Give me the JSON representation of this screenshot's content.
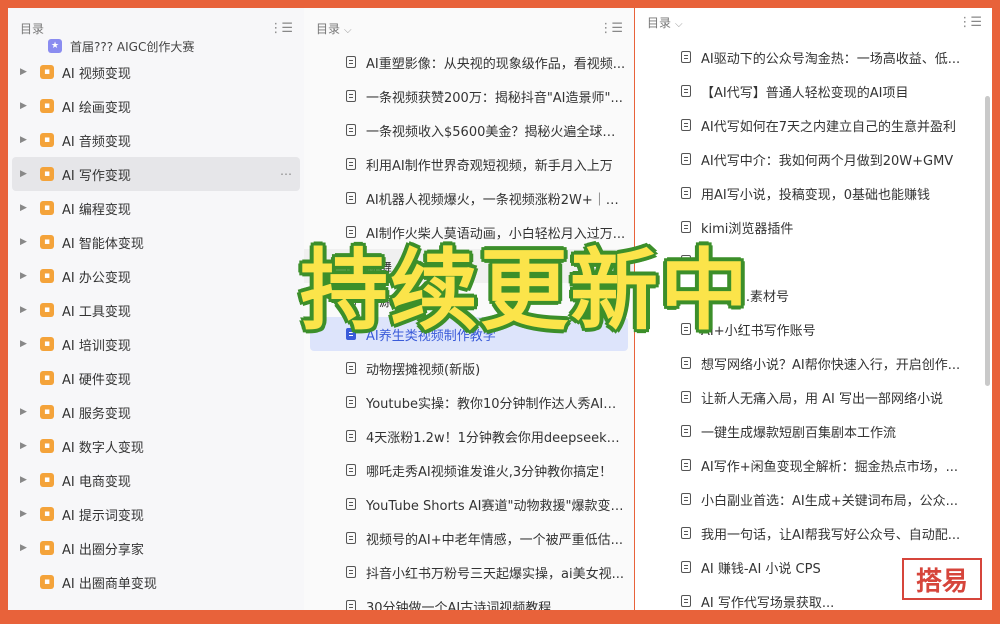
{
  "pane1": {
    "header": "目录",
    "first_item": "首届??? AIGC创作大赛",
    "items": [
      {
        "label": "AI 视频变现"
      },
      {
        "label": "AI 绘画变现"
      },
      {
        "label": "AI 音频变现"
      },
      {
        "label": "AI 写作变现"
      },
      {
        "label": "AI 编程变现"
      },
      {
        "label": "AI 智能体变现"
      },
      {
        "label": "AI 办公变现"
      },
      {
        "label": "AI 工具变现"
      },
      {
        "label": "AI 培训变现"
      },
      {
        "label": "AI 硬件变现"
      },
      {
        "label": "AI 服务变现"
      },
      {
        "label": "AI 数字人变现"
      },
      {
        "label": "AI 电商变现"
      },
      {
        "label": "AI 提示词变现"
      },
      {
        "label": "AI 出圈分享家"
      },
      {
        "label": "AI 出圈商单变现"
      }
    ]
  },
  "pane2": {
    "header": "目录",
    "items": [
      "AI重塑影像：从央视的现象级作品，看视频...",
      "一条视频获赞200万：揭秘抖音\"AI造景师\"...",
      "一条视频收入$5600美金？揭秘火遍全球的\"...",
      "利用AI制作世界奇观短视频，新手月入上万",
      "AI机器人视频爆火，一条视频涨粉2W+｜图...",
      "AI制作火柴人莫语动画，小白轻松月入过万...",
      "跳舞...",
      "龙源...",
      "AI养生类视频制作教学",
      "动物摆摊视频(新版)",
      "Youtube实操：教你10分钟制作达人秀AI变...",
      "4天涨粉1.2w！1分钟教会你用deepseek制...",
      "哪吒走秀AI视频谁发谁火,3分钟教你搞定！",
      "YouTube Shorts AI赛道\"动物救援\"爆款变种...",
      "视频号的AI+中老年情感，一个被严重低估...",
      "抖音小红书万粉号三天起爆实操，ai美女视...",
      "30分钟做一个AI古诗词视频教程"
    ]
  },
  "pane3": {
    "header": "目录",
    "items": [
      "AI驱动下的公众号淘金热：一场高收益、低...",
      "【AI代写】普通人轻松变现的AI项目",
      "AI代写如何在7天之内建立自己的生意并盈利",
      "AI代写中介：我如何两个月做到20W+GMV",
      "用AI写小说，投稿变现，0基础也能赚钱",
      "kimi浏览器插件",
      "AI...",
      "AI+古...素材号",
      "AI+小红书写作账号",
      "想写网络小说？AI帮你快速入行，开启创作...",
      "让新人无痛入局，用 AI 写出一部网络小说",
      "一键生成爆款短剧百集剧本工作流",
      "AI写作+闲鱼变现全解析：掘金热点市场，...",
      "小白副业首选：AI生成+关键词布局，公众...",
      "我用一句话，让AI帮我写好公众号、自动配...",
      "AI 赚钱-AI 小说 CPS",
      "AI 写作代写场景获取..."
    ]
  },
  "overlay_text": "持续更新中",
  "watermark_text": "搭易",
  "colors": {
    "accent": "#3a5bd9",
    "frame": "#e8623a",
    "category_icon": "#f4a33a",
    "overlay_fill": "#fbe44a",
    "overlay_stroke": "#3c8f2a"
  }
}
